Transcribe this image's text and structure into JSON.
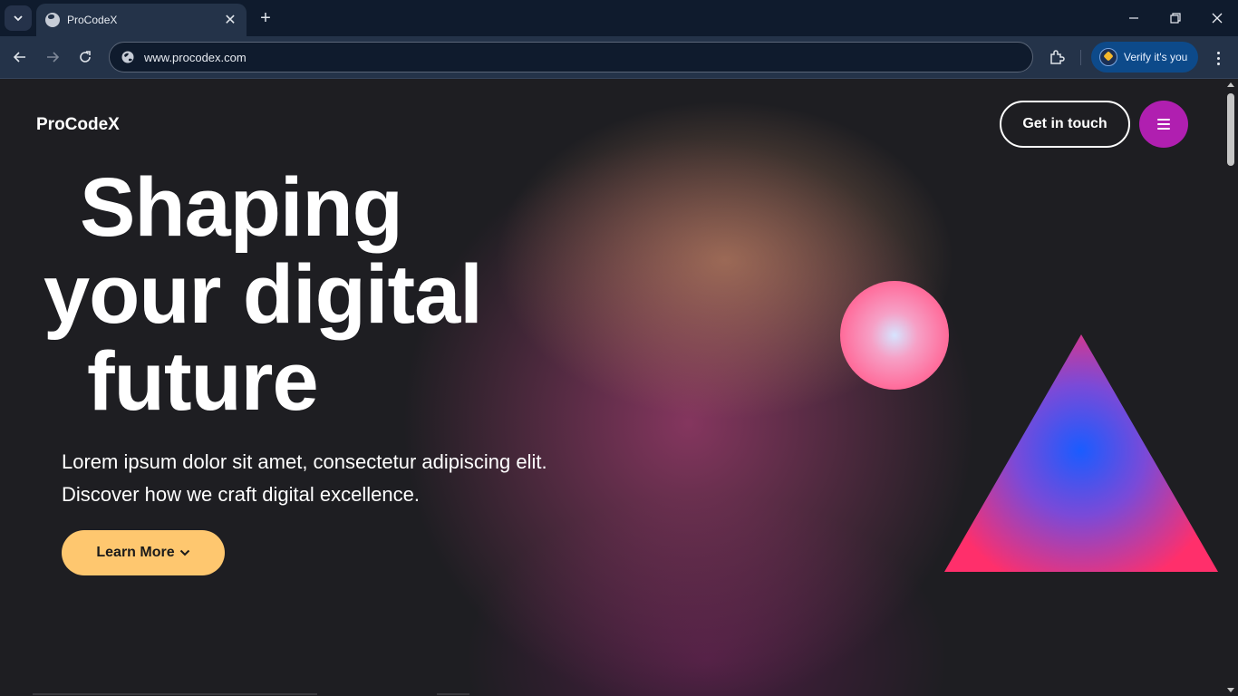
{
  "browser": {
    "tab": {
      "title": "ProCodeX",
      "close_glyph": "✕"
    },
    "new_tab_glyph": "+",
    "window_controls": {
      "minimize": "—",
      "restore": "❐",
      "close": "✕"
    },
    "address": {
      "url": "www.procodex.com",
      "icon": "site-info-icon"
    },
    "profile": {
      "label": "Verify it's you"
    }
  },
  "site": {
    "logo": "ProCodeX",
    "nav": {
      "cta_label": "Get in touch",
      "menu_icon": "hamburger-icon"
    },
    "hero": {
      "title_lines": [
        "Shaping",
        "your digital",
        "future"
      ],
      "lead_lines": [
        "Lorem ipsum dolor sit amet, consectetur adipiscing elit.",
        "Discover how we craft digital excellence."
      ],
      "button_label": "Learn More",
      "button_icon": "chevron-down-icon"
    },
    "colors": {
      "background": "#1e1e22",
      "accent_menu": "#b01fb0",
      "button": "#fec76f",
      "sphere": "#ff6b9a",
      "triangle_center": "#1a5cff",
      "triangle_edge": "#ff2f6b"
    }
  }
}
